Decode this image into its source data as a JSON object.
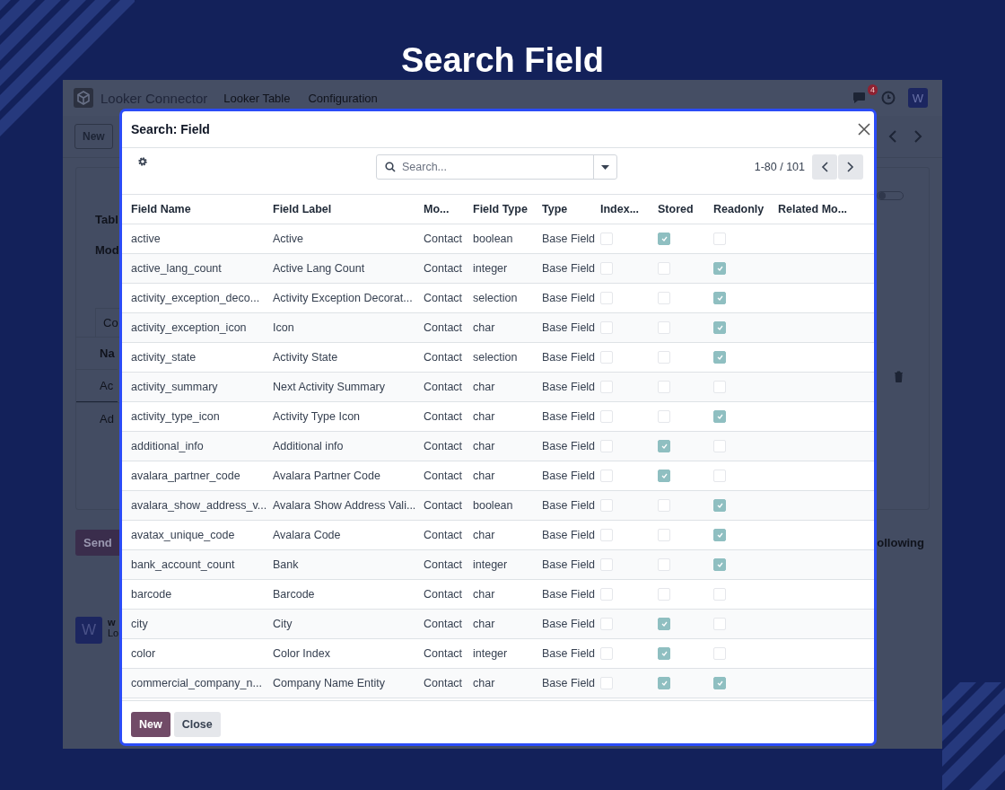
{
  "page_title": "Search Field",
  "app": {
    "brand": "Looker Connector",
    "menu": [
      "Looker Table",
      "Configuration"
    ],
    "chat_badge": "4",
    "avatar": "W",
    "new_button": "New",
    "form_fragments": [
      "Tabl",
      "Mod"
    ],
    "tab_fragment": "Co",
    "list_fragments": [
      "Na",
      "Ac",
      "Ad"
    ],
    "toggle": {
      "on": false
    },
    "send_button": "Send",
    "following": "ollowing",
    "message": {
      "avatar": "W",
      "author": "w",
      "text": "Lo"
    }
  },
  "dialog": {
    "title": "Search: Field",
    "search": {
      "placeholder": "Search..."
    },
    "pager": "1-80 / 101",
    "columns": [
      "Field Name",
      "Field Label",
      "Mo...",
      "Field Type",
      "Type",
      "Index...",
      "Stored",
      "Readonly",
      "Related Mo..."
    ],
    "rows": [
      {
        "name": "active",
        "label": "Active",
        "model": "Contact",
        "field_type": "boolean",
        "type": "Base Field",
        "indexed": false,
        "stored": true,
        "readonly": false
      },
      {
        "name": "active_lang_count",
        "label": "Active Lang Count",
        "model": "Contact",
        "field_type": "integer",
        "type": "Base Field",
        "indexed": false,
        "stored": false,
        "readonly": true
      },
      {
        "name": "activity_exception_deco...",
        "label": "Activity Exception Decorat...",
        "model": "Contact",
        "field_type": "selection",
        "type": "Base Field",
        "indexed": false,
        "stored": false,
        "readonly": true
      },
      {
        "name": "activity_exception_icon",
        "label": "Icon",
        "model": "Contact",
        "field_type": "char",
        "type": "Base Field",
        "indexed": false,
        "stored": false,
        "readonly": true
      },
      {
        "name": "activity_state",
        "label": "Activity State",
        "model": "Contact",
        "field_type": "selection",
        "type": "Base Field",
        "indexed": false,
        "stored": false,
        "readonly": true
      },
      {
        "name": "activity_summary",
        "label": "Next Activity Summary",
        "model": "Contact",
        "field_type": "char",
        "type": "Base Field",
        "indexed": false,
        "stored": false,
        "readonly": false
      },
      {
        "name": "activity_type_icon",
        "label": "Activity Type Icon",
        "model": "Contact",
        "field_type": "char",
        "type": "Base Field",
        "indexed": false,
        "stored": false,
        "readonly": true
      },
      {
        "name": "additional_info",
        "label": "Additional info",
        "model": "Contact",
        "field_type": "char",
        "type": "Base Field",
        "indexed": false,
        "stored": true,
        "readonly": false
      },
      {
        "name": "avalara_partner_code",
        "label": "Avalara Partner Code",
        "model": "Contact",
        "field_type": "char",
        "type": "Base Field",
        "indexed": false,
        "stored": true,
        "readonly": false
      },
      {
        "name": "avalara_show_address_v...",
        "label": "Avalara Show Address Vali...",
        "model": "Contact",
        "field_type": "boolean",
        "type": "Base Field",
        "indexed": false,
        "stored": false,
        "readonly": true
      },
      {
        "name": "avatax_unique_code",
        "label": "Avalara Code",
        "model": "Contact",
        "field_type": "char",
        "type": "Base Field",
        "indexed": false,
        "stored": false,
        "readonly": true
      },
      {
        "name": "bank_account_count",
        "label": "Bank",
        "model": "Contact",
        "field_type": "integer",
        "type": "Base Field",
        "indexed": false,
        "stored": false,
        "readonly": true
      },
      {
        "name": "barcode",
        "label": "Barcode",
        "model": "Contact",
        "field_type": "char",
        "type": "Base Field",
        "indexed": false,
        "stored": false,
        "readonly": false
      },
      {
        "name": "city",
        "label": "City",
        "model": "Contact",
        "field_type": "char",
        "type": "Base Field",
        "indexed": false,
        "stored": true,
        "readonly": false
      },
      {
        "name": "color",
        "label": "Color Index",
        "model": "Contact",
        "field_type": "integer",
        "type": "Base Field",
        "indexed": false,
        "stored": true,
        "readonly": false
      },
      {
        "name": "commercial_company_n...",
        "label": "Company Name Entity",
        "model": "Contact",
        "field_type": "char",
        "type": "Base Field",
        "indexed": false,
        "stored": true,
        "readonly": true
      }
    ],
    "buttons": [
      {
        "label": "New",
        "kind": "primary"
      },
      {
        "label": "Close",
        "kind": "secondary"
      }
    ]
  }
}
